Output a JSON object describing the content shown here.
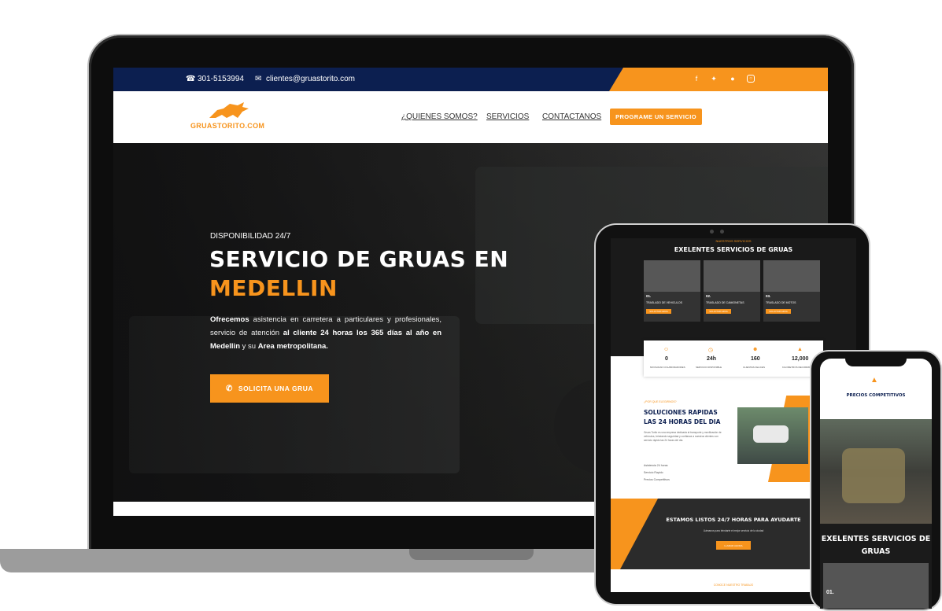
{
  "topbar": {
    "phone": "301-5153994",
    "email": "clientes@gruastorito.com",
    "social_icons": [
      "facebook-icon",
      "twitter-icon",
      "whatsapp-icon",
      "instagram-icon"
    ]
  },
  "nav": {
    "logo_text": "GRUASTORITO.COM",
    "links": [
      "¿QUIENES SOMOS?",
      "SERVICIOS",
      "CONTACTANOS"
    ],
    "cta": "PROGRAME UN SERVICIO"
  },
  "hero": {
    "kicker": "DISPONIBILIDAD 24/7",
    "title_line1": "SERVICIO DE GRUAS EN",
    "title_line2": "MEDELLIN",
    "para_b1": "Ofrecemos",
    "para_1": " asistencia en carretera a particulares y profesionales, servicio de atención ",
    "para_b2": "al cliente 24 horas los 365 días al año en Medellin",
    "para_2": " y su ",
    "para_b3": "Area metropolitana.",
    "button": "SOLICITA UNA GRUA"
  },
  "tablet": {
    "services_kicker": "NUESTROS SERVICIOS",
    "services_title": "EXELENTES SERVICIOS DE GRUAS",
    "cards": [
      {
        "num": "01.",
        "title": "TRASLADO DE VEHICULOS",
        "button": "SOLICITAR GRUA"
      },
      {
        "num": "02.",
        "title": "TRASLADO DE CAMIONETAS",
        "button": "SOLICITAR GRUA"
      },
      {
        "num": "03.",
        "title": "TRASLADO DE MOTOS",
        "button": "SOLICITAR GRUA"
      }
    ],
    "stats": [
      {
        "num": "0",
        "label": "MOVILIDAD COLABORADORES"
      },
      {
        "num": "24h",
        "label": "SERVICIO DISPONIBLE"
      },
      {
        "num": "160",
        "label": "CLIENTES FELICES"
      },
      {
        "num": "12,000",
        "label": "KILOMETROS RECORRIDOS"
      }
    ],
    "why_kicker": "¿POR QUE ELEGIRNOS?",
    "why_title_1": "SOLUCIONES RAPIDAS",
    "why_title_2": "LAS 24 HORAS DEL DIA",
    "why_para": "Gruas Torito es una empresa dedicada al transporte y movilización de vehículos, brindando seguridad y confianza a nuestros clientes con servicio rápido las 24 horas del día.",
    "bullets": [
      "Asistencia 24 horas",
      "Servicio Rapido",
      "Precios Competitivos"
    ],
    "banner_title": "ESTAMOS LISTOS 24/7 HORAS PARA AYUDARTE",
    "banner_text": "Llámanos para brindarte el mejor servicio de la ciudad",
    "banner_button": "LLAMAR AHORA",
    "footer_kicker": "CONOCE NUESTRO TRABAJO"
  },
  "phone": {
    "title1": "PRECIOS COMPETITIVOS",
    "title2": "EXELENTES SERVICIOS DE GRUAS",
    "card_num": "01."
  },
  "colors": {
    "accent": "#f7941d",
    "navy": "#0c1f50"
  }
}
